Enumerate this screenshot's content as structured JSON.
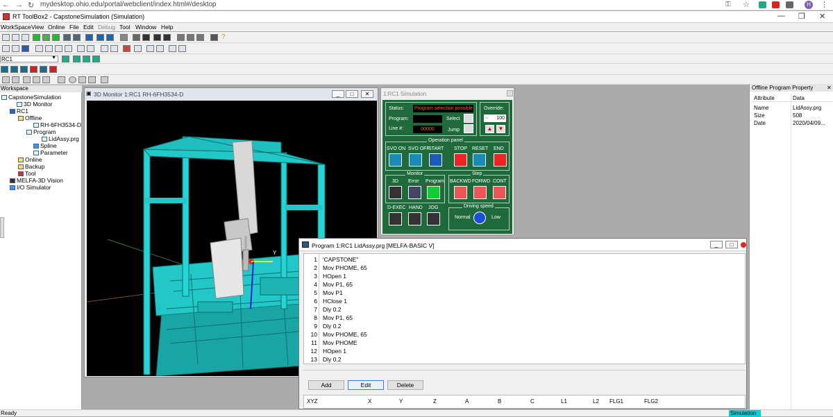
{
  "browser": {
    "url": "mydesktop.ohio.edu/portal/webclient/index.html#/desktop",
    "avatar": "H"
  },
  "app": {
    "title": "RT ToolBox2 - CapstoneSimulation  (Simulation)"
  },
  "menu": [
    "WorkSpace",
    "View",
    "Online",
    "File",
    "Edit",
    "Debug",
    "Tool",
    "Window",
    "Help"
  ],
  "robot_select": {
    "value": "RC1"
  },
  "workspace": {
    "header": "Workspace",
    "tree": [
      {
        "label": "CapstoneSimulation",
        "icon": "workspace-icon"
      },
      {
        "label": "3D Monitor",
        "icon": "monitor-icon"
      },
      {
        "label": "RC1",
        "icon": "robot-controller-icon"
      },
      {
        "label": "Offline",
        "icon": "folder-icon"
      },
      {
        "label": "RH-6FH3534-D",
        "icon": "robot-arm-icon"
      },
      {
        "label": "Program",
        "icon": "folder-icon"
      },
      {
        "label": "LidAssy.prg",
        "icon": "program-file-icon"
      },
      {
        "label": "Spline",
        "icon": "spline-icon"
      },
      {
        "label": "Parameter",
        "icon": "parameter-icon"
      },
      {
        "label": "Online",
        "icon": "folder-icon"
      },
      {
        "label": "Backup",
        "icon": "folder-icon"
      },
      {
        "label": "Tool",
        "icon": "tool-icon"
      },
      {
        "label": "MELFA-3D Vision",
        "icon": "vision-icon"
      },
      {
        "label": "I/O Simulator",
        "icon": "io-icon"
      }
    ]
  },
  "monitor": {
    "title": "3D Monitor 1:RC1 RH-6FH3534-D",
    "axis_label": "Y"
  },
  "sim": {
    "title": "1:RC1  Simulation",
    "status_label": "Status:",
    "status_value": "Program selection possible",
    "program_label": "Program:",
    "line_label": "Line #:",
    "line_value": "00000",
    "select_label": "Select",
    "jump_label": "Jump",
    "override_label": "Override:",
    "override_value": "100",
    "operation_title": "Operation panel",
    "op_buttons": [
      "SVO ON",
      "SVO OFF",
      "START",
      "STOP",
      "RESET",
      "END"
    ],
    "monitor_title": "Monitor",
    "monitor_buttons": [
      "3D",
      "Error",
      "Program"
    ],
    "step_title": "Step",
    "step_buttons": [
      "BACKWD",
      "FORWD",
      "CONT"
    ],
    "extra_buttons": [
      "D-EXEC",
      "HAND",
      "JOG"
    ],
    "speed_title": "Driving speed",
    "speed_normal": "Normal",
    "speed_low": "Low",
    "colors": {
      "panel": "#1e6a3a",
      "status_text": "#ff5a1e"
    }
  },
  "program": {
    "title": "Program 1:RC1 LidAssy.prg  [MELFA-BASIC V]",
    "lines": [
      {
        "n": "1",
        "code": "'CAPSTONE\""
      },
      {
        "n": "2",
        "code": "Mov PHOME, 65"
      },
      {
        "n": "3",
        "code": "HOpen 1"
      },
      {
        "n": "4",
        "code": "Mov P1, 65"
      },
      {
        "n": "5",
        "code": "Mov P1"
      },
      {
        "n": "6",
        "code": "HClose 1"
      },
      {
        "n": "7",
        "code": "Dly 0.2"
      },
      {
        "n": "8",
        "code": "Mov P1, 65"
      },
      {
        "n": "9",
        "code": "Dly 0.2"
      },
      {
        "n": "10",
        "code": "Mov PHOME, 65"
      },
      {
        "n": "11",
        "code": "Mov PHOME"
      },
      {
        "n": "12",
        "code": "HOpen 1"
      },
      {
        "n": "13",
        "code": "Dly 0.2"
      }
    ],
    "buttons": {
      "add": "Add",
      "edit": "Edit",
      "delete": "Delete"
    },
    "position_headers": [
      "XYZ",
      "X",
      "Y",
      "Z",
      "A",
      "B",
      "C",
      "L1",
      "L2",
      "FLG1",
      "FLG2"
    ]
  },
  "props": {
    "header": "Offline Program Property",
    "col_attr": "Attribute",
    "col_data": "Data",
    "rows": [
      {
        "attr": "Name",
        "data": "LidAssy.prg"
      },
      {
        "attr": "Size",
        "data": "508"
      },
      {
        "attr": "Date",
        "data": "2020/04/09..."
      }
    ]
  },
  "status": {
    "left": "Ready",
    "mode": "Simulation"
  }
}
